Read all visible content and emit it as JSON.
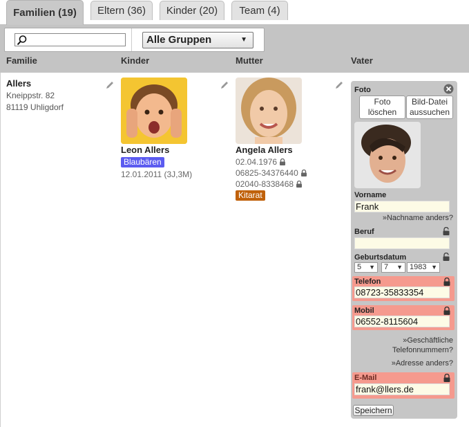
{
  "tabs": [
    {
      "label": "Familien (19)",
      "active": true
    },
    {
      "label": "Eltern (36)",
      "active": false
    },
    {
      "label": "Kinder (20)",
      "active": false
    },
    {
      "label": "Team (4)",
      "active": false
    }
  ],
  "toolbar": {
    "search_value": "",
    "group_select_value": "Alle Gruppen"
  },
  "columns": [
    "Familie",
    "Kinder",
    "Mutter",
    "Vater"
  ],
  "family": {
    "name": "Allers",
    "street": "Kneippstr. 82",
    "city": "81119 Uhligdorf"
  },
  "child": {
    "name": "Leon Allers",
    "group_tag": "Blaubären",
    "birth": "12.01.2011 (3J,3M)",
    "tag_color": "#5b5bf0"
  },
  "mother": {
    "name": "Angela Allers",
    "birthdate": "02.04.1976",
    "phone1": "06825-34376440",
    "phone2": "02040-8338468",
    "tag": "Kitarat",
    "tag_color": "#c0610a"
  },
  "father_form": {
    "foto_label": "Foto",
    "delete_photo_label": "Foto löschen",
    "choose_file_label": "Bild-Datei aussuchen",
    "firstname_label": "Vorname",
    "firstname_value": "Frank",
    "lastname_link": "»Nachname anders?",
    "job_label": "Beruf",
    "job_value": "",
    "birthdate_label": "Geburtsdatum",
    "birth_day": "5",
    "birth_month": "7",
    "birth_year": "1983",
    "phone_label": "Telefon",
    "phone_value": "08723-35833354",
    "mobile_label": "Mobil",
    "mobile_value": "06552-8115604",
    "business_link": "»Geschäftliche Telefonnummern?",
    "address_link": "»Adresse anders?",
    "email_label": "E-Mail",
    "email_value": "frank@llers.de",
    "save_label": "Speichern"
  },
  "colors": {
    "header_band": "#c4c4c4",
    "highlight_red": "#f59a8e",
    "field_bg": "#fdfbe6"
  }
}
